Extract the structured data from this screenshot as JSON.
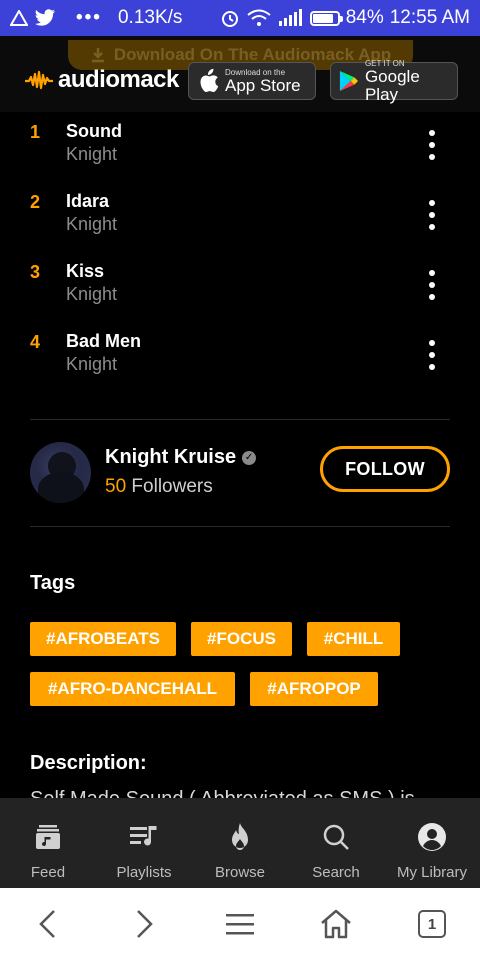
{
  "status_bar": {
    "speed": "0.13K/s",
    "battery_percent": "84%",
    "time": "12:55 AM",
    "battery_level": 0.84
  },
  "header": {
    "banner_text": "Download On The Audiomack App",
    "logo_text": "audiomack",
    "app_store": {
      "small": "Download on the",
      "big": "App Store"
    },
    "google_play": {
      "small": "GET IT ON",
      "big": "Google Play"
    }
  },
  "tracks": [
    {
      "number": "1",
      "title": "Sound",
      "artist": "Knight"
    },
    {
      "number": "2",
      "title": "Idara",
      "artist": "Knight"
    },
    {
      "number": "3",
      "title": "Kiss",
      "artist": "Knight"
    },
    {
      "number": "4",
      "title": "Bad Men",
      "artist": "Knight"
    }
  ],
  "artist": {
    "name": "Knight Kruise",
    "followers_count": "50",
    "followers_label": "Followers",
    "follow_label": "FOLLOW"
  },
  "tags_title": "Tags",
  "tags": [
    "#AFROBEATS",
    "#FOCUS",
    "#CHILL",
    "#AFRO-DANCEHALL",
    "#AFROPOP"
  ],
  "description_title": "Description:",
  "description_text": "Self Made Sound ( Abbreviated as SMS ) is",
  "bottom_nav": [
    {
      "label": "Feed",
      "icon": "feed-icon"
    },
    {
      "label": "Playlists",
      "icon": "playlists-icon"
    },
    {
      "label": "Browse",
      "icon": "browse-flame-icon"
    },
    {
      "label": "Search",
      "icon": "search-icon"
    },
    {
      "label": "My Library",
      "icon": "user-icon"
    }
  ],
  "browser": {
    "tab_count": "1"
  },
  "colors": {
    "accent": "#ffa200",
    "status_bar": "#3c41d8",
    "nav_bg": "#232323"
  }
}
